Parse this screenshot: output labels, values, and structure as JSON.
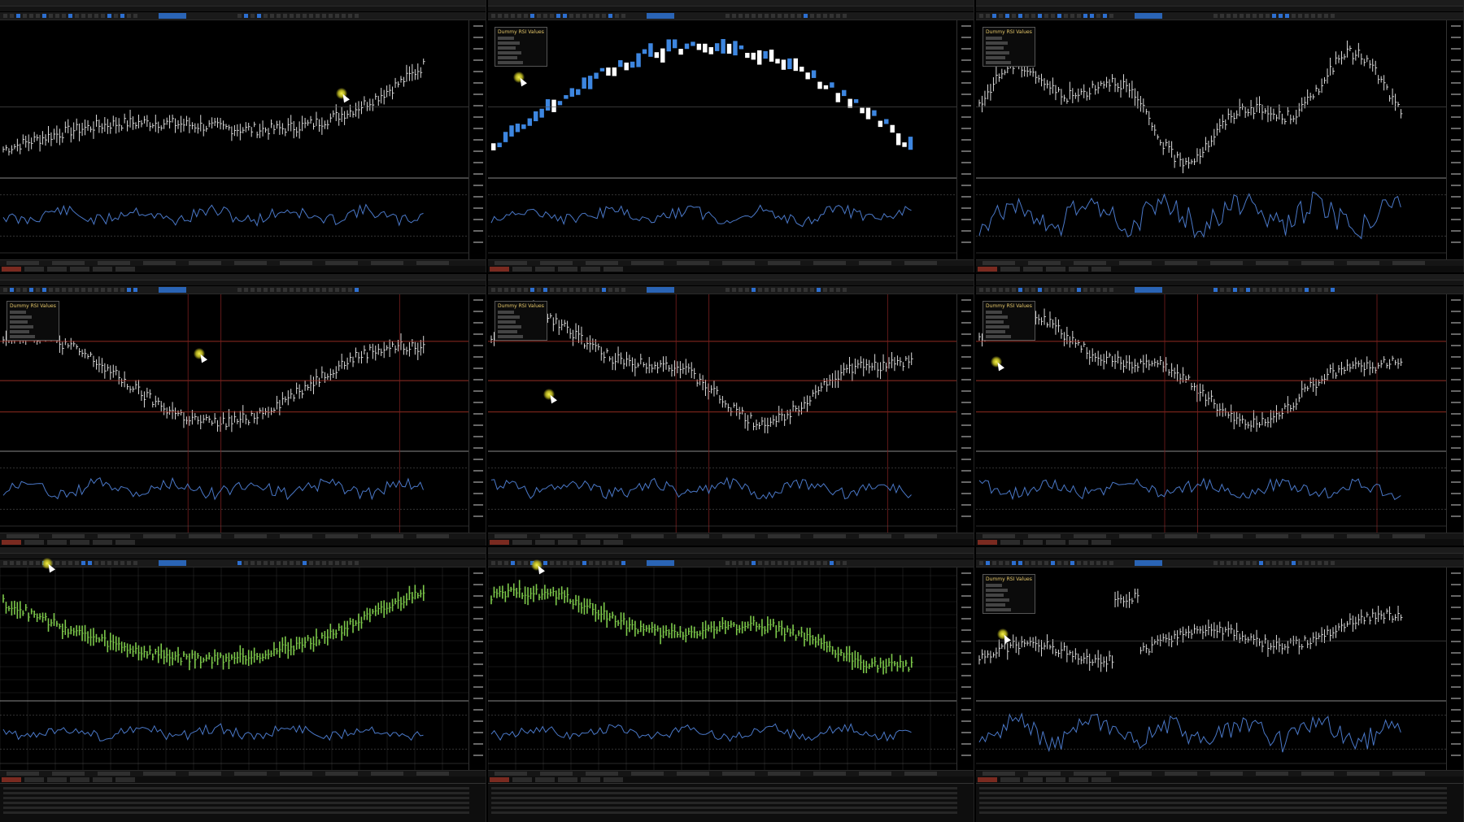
{
  "layout": "3x3 grid of trading platform chart windows",
  "colors": {
    "background": "#000000",
    "price_white": "#f2f2f2",
    "price_blue": "#3d86e0",
    "price_green": "#7cc84a",
    "rsi_blue": "#4a78c8",
    "red_line": "#c0392b",
    "grid": "#2a2a2a",
    "legend_title": "#e8c96a",
    "cursor_glow": "#f7f34a"
  },
  "panels": [
    {
      "id": "p1",
      "title": "",
      "legend": null,
      "style": "bars-white",
      "cursor": true,
      "variant": "uptrend"
    },
    {
      "id": "p2",
      "title": "",
      "legend": {
        "title": "Dummy RSI Values"
      },
      "style": "candles-blue",
      "cursor": true,
      "variant": "bigswing"
    },
    {
      "id": "p3",
      "title": "",
      "legend": {
        "title": "Dummy RSI Values"
      },
      "style": "bars-white",
      "cursor": false,
      "variant": "choppy"
    },
    {
      "id": "p4",
      "title": "",
      "legend": {
        "title": "Dummy RSI Values"
      },
      "style": "bars-white",
      "cursor": true,
      "variant": "wave",
      "tooltip": ""
    },
    {
      "id": "p5",
      "title": "",
      "legend": {
        "title": "Dummy RSI Values"
      },
      "style": "bars-white",
      "cursor": true,
      "variant": "wave2"
    },
    {
      "id": "p6",
      "title": "",
      "legend": {
        "title": "Dummy RSI Values"
      },
      "style": "bars-white",
      "cursor": true,
      "variant": "wave2"
    },
    {
      "id": "p7",
      "title": "",
      "legend": null,
      "style": "bars-green",
      "cursor": true,
      "variant": "downup",
      "terminal": true
    },
    {
      "id": "p8",
      "title": "",
      "legend": null,
      "style": "bars-green",
      "cursor": true,
      "variant": "down",
      "terminal": true,
      "tooltip": ""
    },
    {
      "id": "p9",
      "title": "",
      "legend": {
        "title": "Dummy RSI Values"
      },
      "style": "bars-white",
      "cursor": true,
      "variant": "spike",
      "terminal": true
    }
  ]
}
